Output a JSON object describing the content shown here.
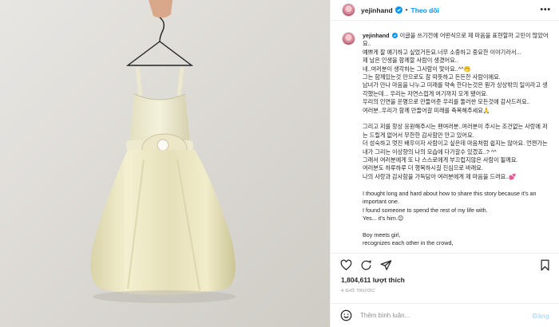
{
  "header": {
    "username": "yejinhand",
    "separator": "•",
    "follow_label": "Theo dõi",
    "more_icon": "more-horizontal-icon"
  },
  "caption": {
    "username": "yejinhand",
    "lines": [
      "이글을 쓰기전에 어떤식으로 제 마음을 표현할까 고민이 많았어요..",
      "예쁘게 잘 얘기하고 싶었거든요.너무 소중하고 중요한 이야기라서...",
      "제 남은 인생을 함께할 사람이 생겼어요..",
      "네..여러분이 생각하는 그사람이 맞아요..^^🤭",
      "그는 함께있는것 만으로도 참 따뜻하고 든든한 사람이에요.",
      "남녀가 만나 마음을 나누고 미래를 약속 한다는것은 뭔가 상상밖의 일이라고 생각했는데... 우리는 자연스럽게 여기까지 오게 됐어요.",
      "우리의 인연을 운명으로 만들어준 우리를 둘러싼 모든것에 감사드려요..",
      "여러분..우리가 함께 만들어갈 미래를 축복해주세요🙏",
      "",
      "그리고 저를 항상 응원해주시는 팬여러분..여러분이 주시는 조건없는 사랑에 저는 드릴게 없어서 무한한 감사함만 안고 있어요.",
      "더 성숙하고 멋진 배우이자 사람이고 싶은데 마음처럼 쉽지는 않아요. 언젠가는 내가 그리는 이상향의 나의 모습에 다가갈수 있겠죠..? ^^",
      "그래서 여러분에게 또 나 스스로에게 부끄럽지않은 사람이 될께요.",
      "여러분도 하루하루 더 행복하시길 진심으로 바래요.",
      "나의 사랑과 감사함을 가득담아 여러분에게 제 마음을 드려요..💕",
      "",
      "I thought long and hard about how to share this story because it's an important one.",
      "I found someone to spend the rest of my life with.",
      "Yes... it's him.😊",
      "",
      "Boy meets girl,",
      "recognizes each other in the crowd,"
    ]
  },
  "footer": {
    "likes": "1,804,611 lượt thích",
    "time": "4 GIỜ TRƯỚC",
    "comment_placeholder": "Thêm bình luận...",
    "post_label": "Đăng",
    "icons": [
      "heart-icon",
      "comment-icon",
      "share-icon",
      "bookmark-icon",
      "emoji-icon"
    ]
  },
  "colors": {
    "accent": "#0095f6",
    "muted": "#8e8e8e",
    "border": "#efefef",
    "post_disabled": "#b2dffc"
  }
}
